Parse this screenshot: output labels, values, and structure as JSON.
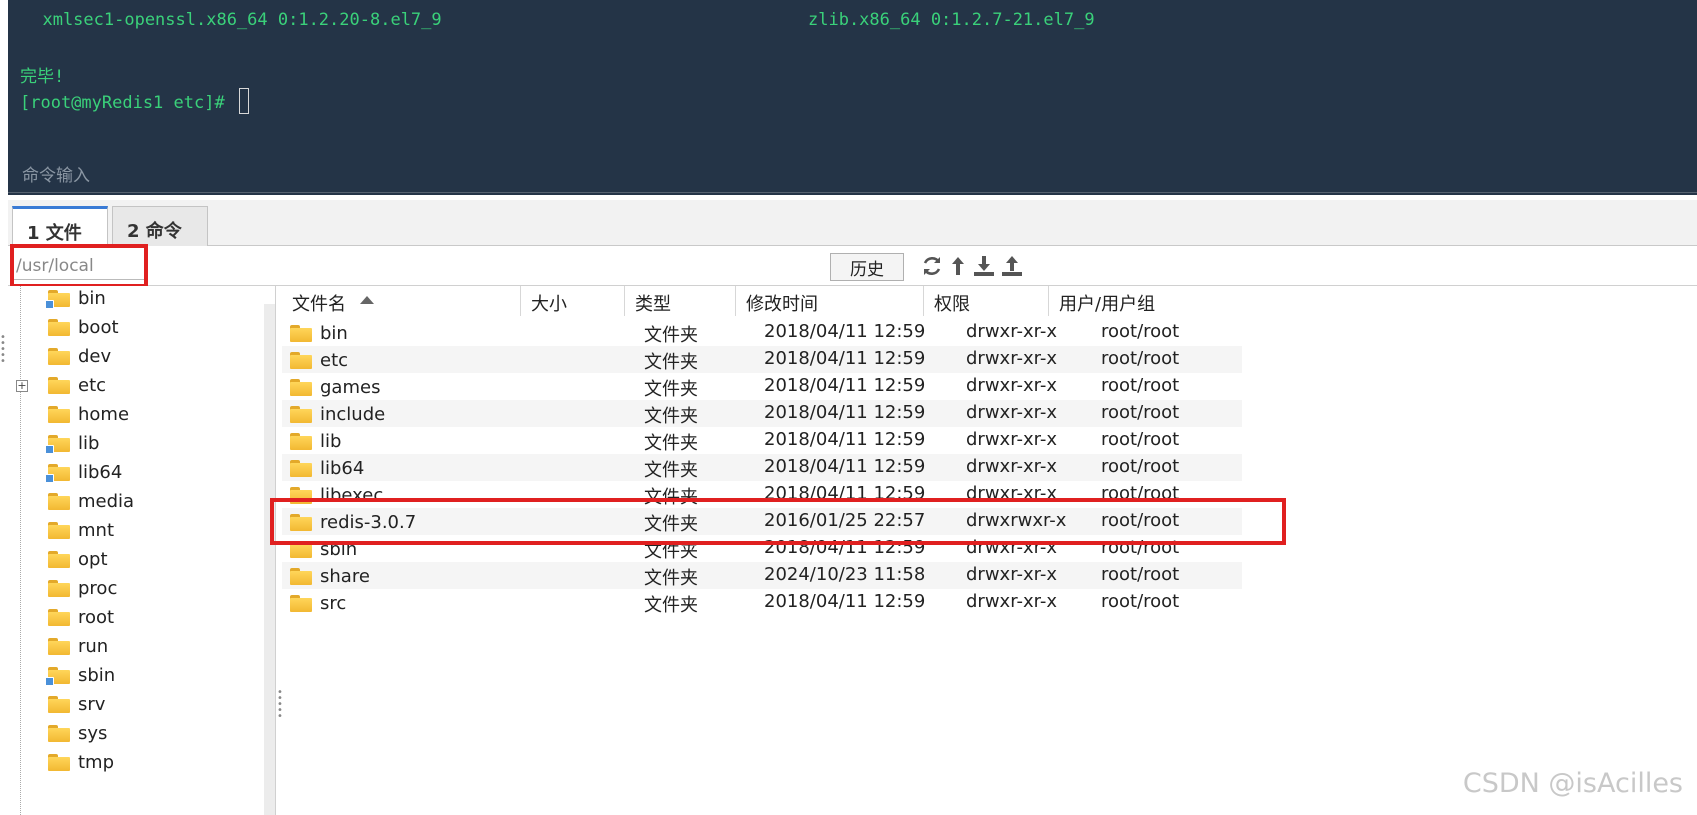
{
  "terminal": {
    "line_left": "  xmlsec1-openssl.x86_64 0:1.2.20-8.el7_9",
    "line_right": "zlib.x86_64 0:1.2.7-21.el7_9",
    "done_text": "完毕!",
    "prompt": "[root@myRedis1 etc]# ",
    "command_placeholder": "命令输入",
    "text_color": "#3ad17a",
    "background": "#243447"
  },
  "tabs": [
    {
      "label": "1 文件",
      "active": true
    },
    {
      "label": "2 命令",
      "active": false
    }
  ],
  "path_bar": {
    "path_value": "/usr/local",
    "history_label": "历史",
    "icons": [
      "refresh-icon",
      "up-arrow-icon",
      "download-icon",
      "upload-icon"
    ]
  },
  "tree": {
    "items": [
      {
        "label": "bin",
        "link": true
      },
      {
        "label": "boot",
        "link": false
      },
      {
        "label": "dev",
        "link": false
      },
      {
        "label": "etc",
        "link": false,
        "expandable": true
      },
      {
        "label": "home",
        "link": false
      },
      {
        "label": "lib",
        "link": true
      },
      {
        "label": "lib64",
        "link": true
      },
      {
        "label": "media",
        "link": false
      },
      {
        "label": "mnt",
        "link": false
      },
      {
        "label": "opt",
        "link": false
      },
      {
        "label": "proc",
        "link": false
      },
      {
        "label": "root",
        "link": false
      },
      {
        "label": "run",
        "link": false
      },
      {
        "label": "sbin",
        "link": true
      },
      {
        "label": "srv",
        "link": false
      },
      {
        "label": "sys",
        "link": false
      },
      {
        "label": "tmp",
        "link": false
      }
    ]
  },
  "file_list": {
    "columns": [
      "文件名",
      "大小",
      "类型",
      "修改时间",
      "权限",
      "用户/用户组"
    ],
    "rows": [
      {
        "name": "bin",
        "size": "",
        "type": "文件夹",
        "mtime": "2018/04/11 12:59",
        "perm": "drwxr-xr-x",
        "owner": "root/root"
      },
      {
        "name": "etc",
        "size": "",
        "type": "文件夹",
        "mtime": "2018/04/11 12:59",
        "perm": "drwxr-xr-x",
        "owner": "root/root"
      },
      {
        "name": "games",
        "size": "",
        "type": "文件夹",
        "mtime": "2018/04/11 12:59",
        "perm": "drwxr-xr-x",
        "owner": "root/root"
      },
      {
        "name": "include",
        "size": "",
        "type": "文件夹",
        "mtime": "2018/04/11 12:59",
        "perm": "drwxr-xr-x",
        "owner": "root/root"
      },
      {
        "name": "lib",
        "size": "",
        "type": "文件夹",
        "mtime": "2018/04/11 12:59",
        "perm": "drwxr-xr-x",
        "owner": "root/root"
      },
      {
        "name": "lib64",
        "size": "",
        "type": "文件夹",
        "mtime": "2018/04/11 12:59",
        "perm": "drwxr-xr-x",
        "owner": "root/root"
      },
      {
        "name": "libexec",
        "size": "",
        "type": "文件夹",
        "mtime": "2018/04/11 12:59",
        "perm": "drwxr-xr-x",
        "owner": "root/root"
      },
      {
        "name": "redis-3.0.7",
        "size": "",
        "type": "文件夹",
        "mtime": "2016/01/25 22:57",
        "perm": "drwxrwxr-x",
        "owner": "root/root"
      },
      {
        "name": "sbin",
        "size": "",
        "type": "文件夹",
        "mtime": "2018/04/11 12:59",
        "perm": "drwxr-xr-x",
        "owner": "root/root"
      },
      {
        "name": "share",
        "size": "",
        "type": "文件夹",
        "mtime": "2024/10/23 11:58",
        "perm": "drwxr-xr-x",
        "owner": "root/root"
      },
      {
        "name": "src",
        "size": "",
        "type": "文件夹",
        "mtime": "2018/04/11 12:59",
        "perm": "drwxr-xr-x",
        "owner": "root/root"
      }
    ]
  },
  "highlight_color": "#e02020",
  "watermark": "CSDN @isAcilles"
}
